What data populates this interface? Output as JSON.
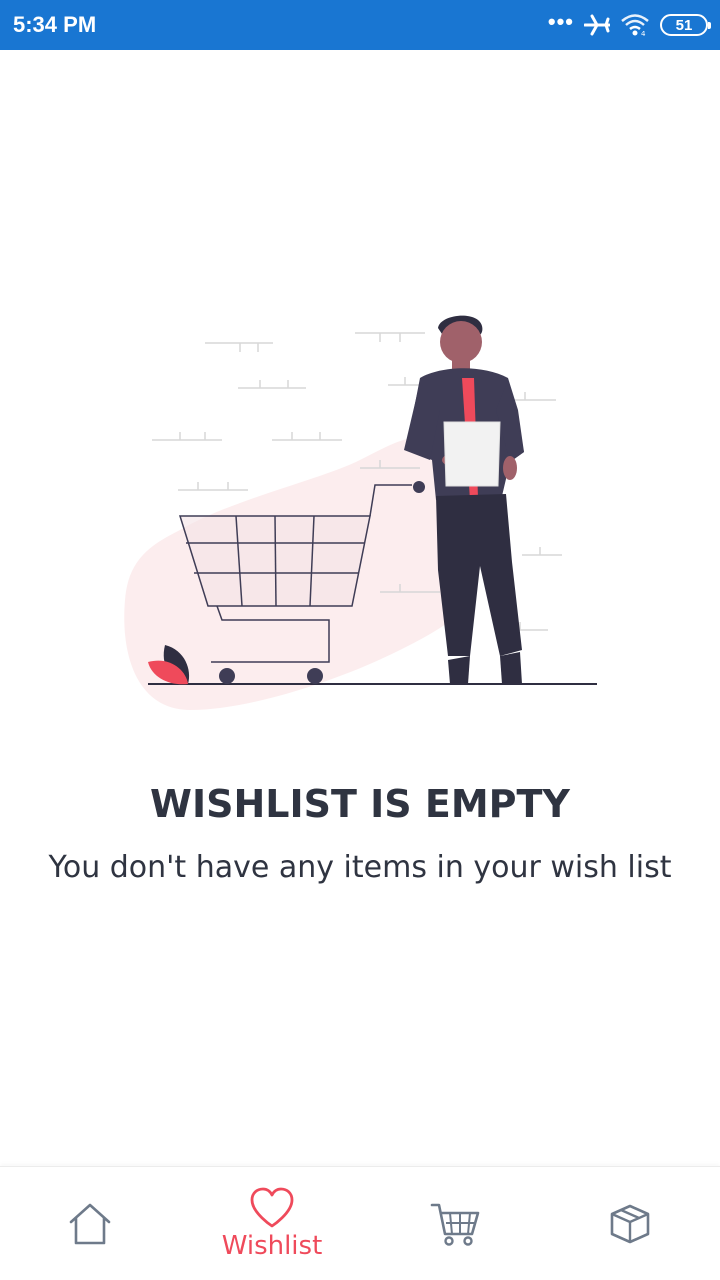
{
  "status_bar": {
    "time": "5:34 PM",
    "dots": "•••",
    "battery": "51",
    "icons": [
      "airplane-icon",
      "wifi-icon",
      "battery-icon"
    ]
  },
  "empty_state": {
    "title": "WISHLIST IS EMPTY",
    "message": "You don't have any items in your wish list",
    "illustration": "person-with-shopping-cart"
  },
  "bottom_nav": {
    "items": [
      {
        "icon": "home-icon",
        "label": "",
        "active": false
      },
      {
        "icon": "heart-icon",
        "label": "Wishlist",
        "active": true
      },
      {
        "icon": "cart-icon",
        "label": "",
        "active": false
      },
      {
        "icon": "box-icon",
        "label": "",
        "active": false
      }
    ]
  },
  "colors": {
    "status_bar": "#1976d2",
    "accent": "#ef4a5b",
    "text_dark": "#2f3441",
    "icon_inactive": "#6e7a8a"
  }
}
